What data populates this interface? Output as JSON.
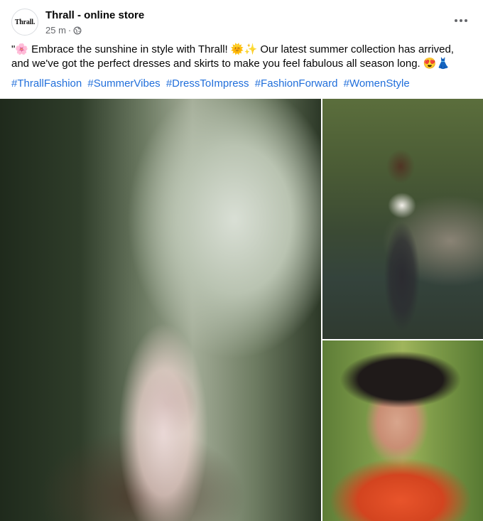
{
  "post": {
    "page_name": "Thrall - online store",
    "avatar_text": "Thrall.",
    "time": "25 m",
    "separator": "·",
    "audience_icon": "globe-icon",
    "more_icon": "more-horizontal-icon",
    "text": "\"🌸 Embrace the sunshine in style with Thrall! 🌞✨ Our latest summer collection has arrived, and we've got the perfect dresses and skirts to make you feel fabulous all season long. 😍👗",
    "hashtags": [
      "#ThrallFashion",
      "#SummerVibes",
      "#DressToImpress",
      "#FashionForward",
      "#WomenStyle"
    ],
    "photos": [
      {
        "alt": "Woman in floral dress on forest path"
      },
      {
        "alt": "Woman in white crop top and patterned skirt by a stream"
      },
      {
        "alt": "Woman in black hat and orange floral shirt in field"
      }
    ]
  },
  "colors": {
    "link": "#216fdb",
    "secondary_text": "#65676b",
    "primary_text": "#050505"
  }
}
